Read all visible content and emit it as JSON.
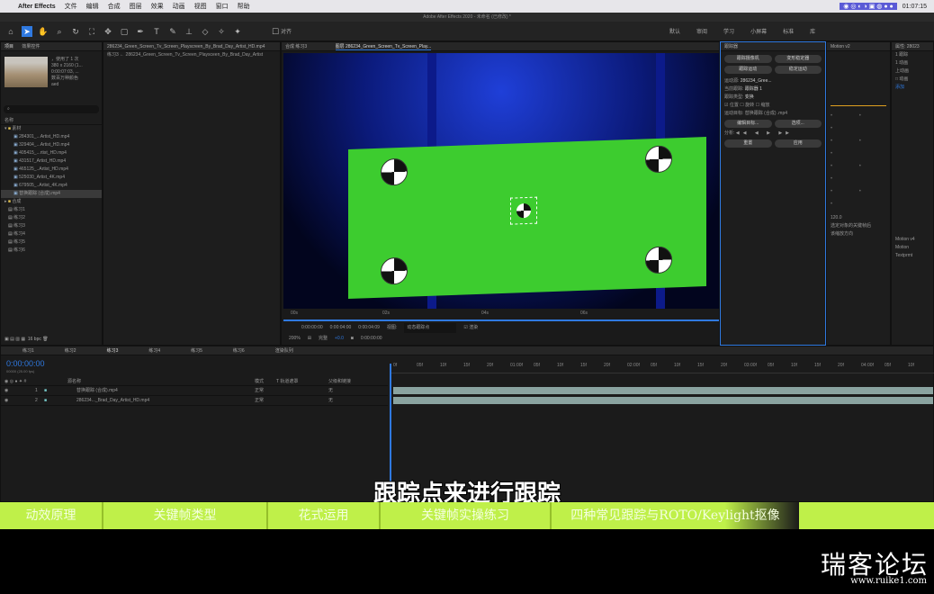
{
  "menubar": {
    "app_name": "After Effects",
    "items": [
      "文件",
      "编辑",
      "合成",
      "图层",
      "效果",
      "动画",
      "视图",
      "窗口",
      "帮助"
    ],
    "time": "01:07:15"
  },
  "window_title": "Adobe After Effects 2020 - 未命名 (已修改) *",
  "workspaces": [
    "默认",
    "审阅",
    "学习",
    "小屏幕",
    "标准",
    "库"
  ],
  "snap_label": "对齐",
  "project": {
    "tab": "项目",
    "tab2": "效果控件",
    "info_line1": "，使用了 1 次",
    "info_line2": "380 x 2160 (1...",
    "info_line3": "0:00:07:03, ...",
    "info_line4": "数百万种颜色",
    "info_line5": "aed",
    "search_placeholder": "",
    "name_header": "名称",
    "folder_label": "素材",
    "files": [
      "284301_...Artist_HD.mp4",
      "329404_...Artist_HD.mp4",
      "405415_...rtist_HD.mp4",
      "431517_Artist_HD.mp4",
      "465125_..Artist_HD.mp4",
      "525030_Artist_4K.mp4",
      "679505_..Artist_4K.mp4",
      "替换跟踪 (合成).mp4"
    ],
    "sub_folder": "合成",
    "comps": [
      "练习1",
      "练习2",
      "练习3",
      "练习4",
      "练习5",
      "练习6"
    ],
    "bpc": "16 bpc"
  },
  "comp_panel": {
    "tab": "合成 练习3",
    "tab2": "286234_Green_Screen_Tv_Screen_Playscreen_By_Brad_Day_Artist_HD.mp4",
    "breadcrumb": "练习3 ← 286234_Green_Screen_Tv_Screen_Playsceen_By_Brad_Day_Artist",
    "footer_tab": "图层 286234_Green_Screen_Tv_Screen_Play..."
  },
  "layer_panel": {
    "ruler": [
      "00s",
      "02s",
      "04s",
      "06s"
    ],
    "timecode_in": "0:00:00:00",
    "timecode_dur": "0:00:04:00",
    "timecode_end": "0:00:04:09",
    "view_label": "视图:",
    "view_value": "动态跟踪点",
    "render_label": "渲染",
    "zoom": "200%",
    "res": "完整",
    "current_time": "0:00:00:00",
    "plus": "+0.0"
  },
  "tracker": {
    "title": "跟踪器",
    "btn1": "跟踪摄像机",
    "btn2": "变形稳定器",
    "btn3": "跟踪运动",
    "btn4": "稳定运动",
    "source_label": "运动源:",
    "source_value": "286234_Gree...",
    "current_track_label": "当前跟踪:",
    "current_track_value": "跟踪器 1",
    "type_label": "跟踪类型:",
    "type_value": "变换",
    "position": "位置",
    "rotation": "旋转",
    "scale": "缩放",
    "target_label": "运动目标:",
    "target_value": "替换跟踪 (合成) .mp4",
    "edit_target": "编辑目标...",
    "options": "选项...",
    "analyze_label": "分析:",
    "reset": "重置",
    "apply": "应用"
  },
  "right_panel": {
    "tab": "Motion v2",
    "tab2": "属性: 28023",
    "items": [
      "1 跟踪",
      "1 动画",
      "上动画",
      "□ 动画",
      "添加"
    ],
    "note1": "选定对象的关键帧后",
    "note2": "该缩放方向",
    "tab3": "Motion v4 精选",
    "label_a": "Motion v4",
    "label_b": "Motion",
    "label_c": "Textprmt",
    "value_a": "120.0"
  },
  "timeline": {
    "tabs": [
      "练习1",
      "练习2",
      "练习3",
      "练习4",
      "练习5",
      "练习6",
      "渲染队列"
    ],
    "timecode": "0:00:00:00",
    "fps": "00000 (25.00 fps)",
    "col_name": "源名称",
    "col_mode": "模式",
    "col_trk": "T 轨道遮罩",
    "col_parent": "父级和链接",
    "layers": [
      {
        "num": "1",
        "name": "替换跟踪 (合成).mp4",
        "mode": "正常",
        "parent": "无"
      },
      {
        "num": "2",
        "name": "286234..._Brad_Day_Artist_HD.mp4",
        "mode": "正常",
        "parent": "无"
      }
    ],
    "ruler": [
      "0f",
      "05f",
      "10f",
      "15f",
      "20f",
      "01:00f",
      "05f",
      "10f",
      "15f",
      "20f",
      "02:00f",
      "05f",
      "10f",
      "15f",
      "20f",
      "03:00f",
      "05f",
      "10f",
      "15f",
      "20f",
      "04:00f",
      "05f",
      "10f"
    ]
  },
  "subtitle": "跟踪点来进行跟踪",
  "chapters": [
    "动效原理",
    "关键帧类型",
    "花式运用",
    "关键帧实操练习",
    "四种常见跟踪与ROTO/Keylight抠像"
  ],
  "watermark": {
    "name": "瑞客论坛",
    "url": "www.ruike1.com"
  },
  "colors": {
    "green_screen": "#3dcc2f",
    "accent_blue": "#2f79e0",
    "chapter_bar": "#bff049"
  }
}
